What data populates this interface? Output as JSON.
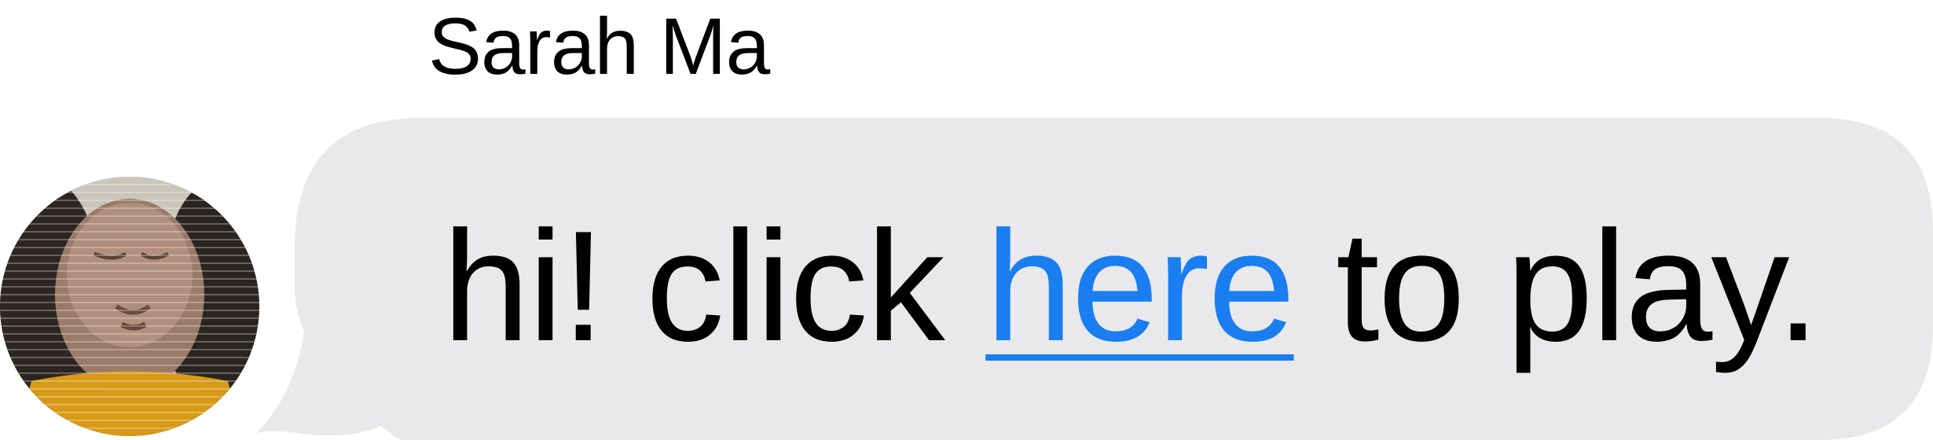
{
  "message": {
    "sender_name": "Sarah Ma",
    "text_before": "hi! click ",
    "link_text": "here",
    "text_after": " to play."
  },
  "colors": {
    "bubble_background": "#e9e9eb",
    "link": "#1a7ef0",
    "text": "#000000"
  },
  "icons": {
    "avatar": "profile-photo"
  }
}
